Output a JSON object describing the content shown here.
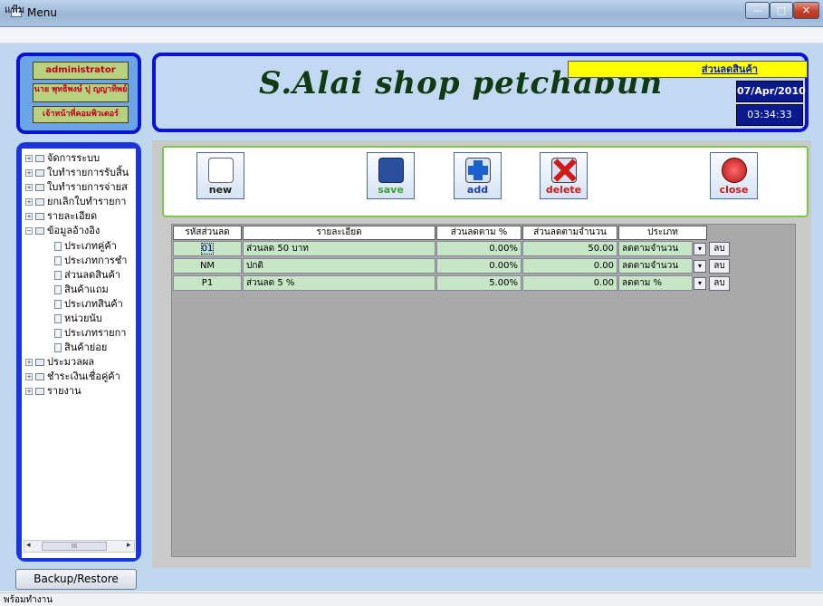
{
  "window": {
    "title": "Menu",
    "min_glyph": "—",
    "max_glyph": "□",
    "close_glyph": "✕"
  },
  "menubar": {
    "file": "แฟ้ม"
  },
  "user": {
    "role": "administrator",
    "name": "นาย พุทธิพงษ์ ปุ ญญาทิพย์",
    "department": "เจ้าหน้าที่คอมพิวเตอร์"
  },
  "header": {
    "shop_name": "S.Alai shop petchabun",
    "page_label": "ส่วนลดสินค้า",
    "date": "07/Apr/2010",
    "time": "03:34:33"
  },
  "nav": {
    "expand_glyph": "+",
    "collapse_glyph": "−",
    "items": [
      {
        "label": "จัดการระบบ"
      },
      {
        "label": "ใบทำรายการรับสิ้น"
      },
      {
        "label": "ใบทำรายการจ่ายส"
      },
      {
        "label": "ยกเลิกใบทำรายกา"
      },
      {
        "label": "รายละเอียด"
      },
      {
        "label": "ข้อมูลอ้างอิง"
      },
      {
        "label": "ประเภทคู่ค้า"
      },
      {
        "label": "ประเภทการชำ"
      },
      {
        "label": "ส่วนลดสินค้า"
      },
      {
        "label": "สินค้าแถม"
      },
      {
        "label": "ประเภทสินค้า"
      },
      {
        "label": "หน่วยนับ"
      },
      {
        "label": "ประเภทรายกา"
      },
      {
        "label": "สินค้าย่อย"
      },
      {
        "label": "ประมวลผล"
      },
      {
        "label": "ชำระเงินเชื่อคู่ค้า"
      },
      {
        "label": "รายงาน"
      }
    ],
    "scroll_left": "◂",
    "scroll_right": "▸",
    "scroll_grip": "III"
  },
  "toolbar": {
    "new": "new",
    "save": "save",
    "add": "add",
    "delete": "delete",
    "close": "close"
  },
  "table": {
    "columns": [
      "รหัสส่วนลด",
      "รายละเอียด",
      "ส่วนลดตาม %",
      "ส่วนลดตามจำนวน",
      "ประเภท"
    ],
    "dropdown_glyph": "▾",
    "rows": [
      {
        "code": "01",
        "detail": "ส่วนลด 50 บาท",
        "percent": "0.00%",
        "amount": "50.00",
        "type": "ลดตามจำนวน",
        "action": "ลบ"
      },
      {
        "code": "NM",
        "detail": "ปกติ",
        "percent": "0.00%",
        "amount": "0.00",
        "type": "ลดตามจำนวน",
        "action": "ลบ"
      },
      {
        "code": "P1",
        "detail": "ส่วนลด 5 %",
        "percent": "5.00%",
        "amount": "0.00",
        "type": "ลดตาม %",
        "action": "ลบ"
      }
    ]
  },
  "footer": {
    "backup_button": "Backup/Restore"
  },
  "status": {
    "text": "พร้อมทำงาน"
  },
  "colors": {
    "panel_border": "#0a13d0",
    "user_button": "#b8d17f",
    "grid_row": "#c6e6c6",
    "banner_text": "#0f3a14"
  }
}
